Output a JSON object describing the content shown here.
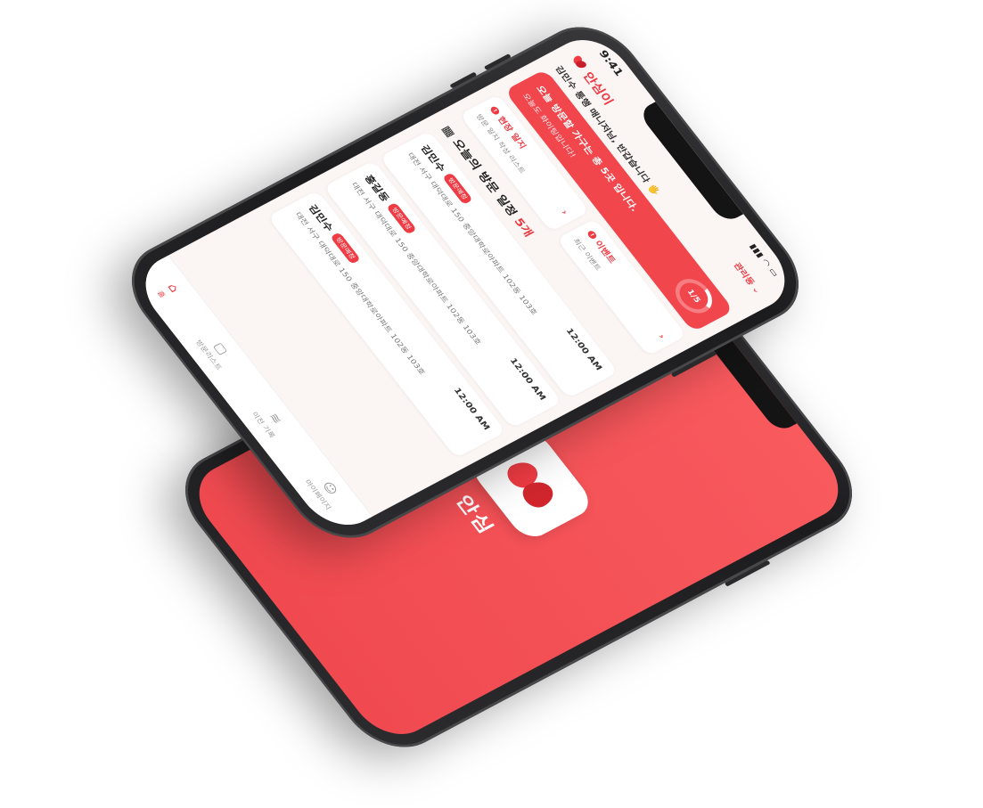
{
  "splash": {
    "app_name": "안심"
  },
  "status_bar": {
    "time": "9:41"
  },
  "header": {
    "brand": "안심이",
    "ward_label": "관리동"
  },
  "greeting": "김민수 통행 매니저님, 반갑습니다 🖐",
  "banner": {
    "title": "오늘 방문할 가구는 총 5곳 입니다.",
    "subtitle": "오늘도 화이팅입니다!",
    "progress_label": "1/5",
    "progress": 0.2
  },
  "quick_cards": [
    {
      "title": "현장 일지",
      "subtitle": "방문 일지 작성 리스트",
      "icon": "!"
    },
    {
      "title": "이벤트",
      "subtitle": "최근 이벤트",
      "icon": "!"
    }
  ],
  "section": {
    "title": "오늘의 방문 일정",
    "count": "5개"
  },
  "visits": [
    {
      "name": "김민수",
      "badge": "방문예정",
      "time": "12:00 AM",
      "address": "대전 서구 대덕대로 150 중앙대학로아파트 102동 103호"
    },
    {
      "name": "홍길동",
      "badge": "방문예정",
      "time": "12:00 AM",
      "address": "대전 서구 대덕대로 150 중앙대학로아파트 102동 103호"
    },
    {
      "name": "김민수",
      "badge": "방문예정",
      "time": "12:00 AM",
      "address": "대전 서구 대덕대로 150 중앙대학로아파트 102동 103호"
    }
  ],
  "tabs": [
    {
      "label": "홈",
      "icon": "home-icon",
      "active": true
    },
    {
      "label": "방문리스트",
      "icon": "clipboard-icon",
      "active": false
    },
    {
      "label": "이전 기록",
      "icon": "layers-icon",
      "active": false
    },
    {
      "label": "마이페이지",
      "icon": "smile-icon",
      "active": false
    }
  ],
  "colors": {
    "accent": "#ef3b43",
    "splash_bg": "#f04a50"
  }
}
